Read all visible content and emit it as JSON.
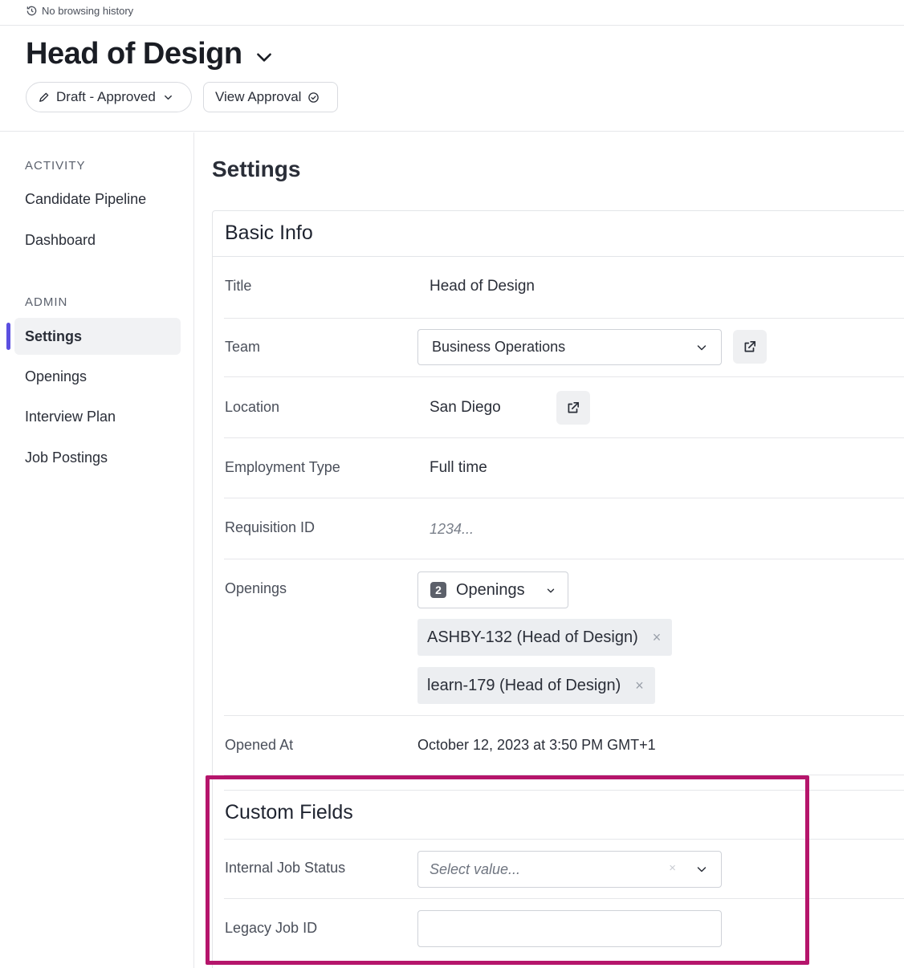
{
  "topbar": {
    "history_text": "No browsing history"
  },
  "header": {
    "job_title": "Head of Design",
    "status_label": "Draft - Approved",
    "approval_label": "View Approval"
  },
  "sidebar": {
    "sections": [
      {
        "title": "ACTIVITY",
        "items": [
          {
            "label": "Candidate Pipeline"
          },
          {
            "label": "Dashboard"
          }
        ]
      },
      {
        "title": "ADMIN",
        "items": [
          {
            "label": "Settings",
            "active": true
          },
          {
            "label": "Openings"
          },
          {
            "label": "Interview Plan"
          },
          {
            "label": "Job Postings"
          }
        ]
      }
    ]
  },
  "main": {
    "title": "Settings",
    "basic_info": {
      "heading": "Basic Info",
      "title_label": "Title",
      "title_value": "Head of Design",
      "team_label": "Team",
      "team_value": "Business Operations",
      "location_label": "Location",
      "location_value": "San Diego",
      "employment_label": "Employment Type",
      "employment_value": "Full time",
      "requisition_label": "Requisition ID",
      "requisition_placeholder": "1234...",
      "openings_label": "Openings",
      "openings_count": "2",
      "openings_select_label": "Openings",
      "opening_tags": [
        {
          "label": "ASHBY-132 (Head of Design)",
          "remove": "×"
        },
        {
          "label": "learn-179 (Head of Design)",
          "remove": "×"
        }
      ],
      "opened_at_label": "Opened At",
      "opened_at_value": "October 12, 2023 at 3:50 PM GMT+1"
    },
    "custom_fields": {
      "heading": "Custom Fields",
      "internal_status_label": "Internal Job Status",
      "internal_status_placeholder": "Select value...",
      "internal_status_clear": "×",
      "legacy_id_label": "Legacy Job ID",
      "legacy_id_value": ""
    }
  },
  "colors": {
    "accent": "#5b4fe0",
    "highlight": "#b5156b"
  }
}
